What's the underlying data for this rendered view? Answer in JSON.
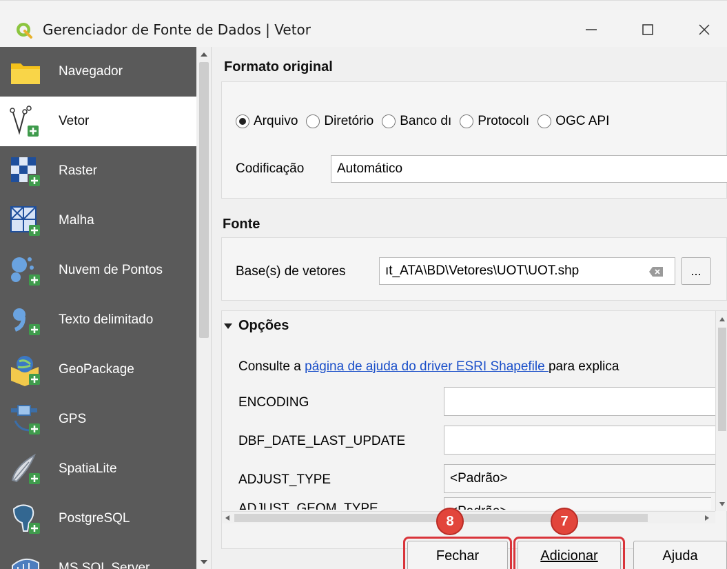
{
  "window": {
    "title": "Gerenciador de Fonte de Dados | Vetor",
    "minimize_glyph": "—",
    "maximize_glyph": "☐",
    "close_glyph": "✕"
  },
  "sidebar": {
    "items": [
      {
        "label": "Navegador",
        "icon": "folder-icon"
      },
      {
        "label": "Vetor",
        "icon": "vector-icon",
        "selected": true
      },
      {
        "label": "Raster",
        "icon": "raster-icon"
      },
      {
        "label": "Malha",
        "icon": "mesh-icon"
      },
      {
        "label": "Nuvem de Pontos",
        "icon": "point-cloud-icon"
      },
      {
        "label": "Texto delimitado",
        "icon": "delimited-text-icon"
      },
      {
        "label": "GeoPackage",
        "icon": "geopackage-icon"
      },
      {
        "label": "GPS",
        "icon": "gps-icon"
      },
      {
        "label": "SpatiaLite",
        "icon": "spatialite-icon"
      },
      {
        "label": "PostgreSQL",
        "icon": "postgresql-icon"
      },
      {
        "label": "MS SQL Server",
        "icon": "mssql-icon"
      }
    ]
  },
  "formato": {
    "title": "Formato original",
    "radios": [
      {
        "label": "Arquivo",
        "checked": true
      },
      {
        "label": "Diretório",
        "checked": false
      },
      {
        "label": "Banco dı",
        "checked": false
      },
      {
        "label": "Protocolı",
        "checked": false
      },
      {
        "label": "OGC API",
        "checked": false
      }
    ],
    "encoding_label": "Codificação",
    "encoding_value": "Automático"
  },
  "fonte": {
    "title": "Fonte",
    "label": "Base(s) de vetores",
    "value": "ıt_ATA\\BD\\Vetores\\UOT\\UOT.shp",
    "browse": "..."
  },
  "opcoes": {
    "title": "Opções",
    "help_prefix": "Consulte a ",
    "help_link": "página de ajuda do driver ESRI Shapefile ",
    "help_suffix": "para explica",
    "rows": [
      {
        "label": "ENCODING",
        "value": ""
      },
      {
        "label": "DBF_DATE_LAST_UPDATE",
        "value": ""
      },
      {
        "label": "ADJUST_TYPE",
        "value": "<Padrão>"
      },
      {
        "label": "ADJUST_GEOM_TYPE",
        "value": "<Padrão>"
      }
    ]
  },
  "buttons": {
    "close": "Fechar",
    "add": "Adicionar",
    "help": "Ajuda"
  },
  "badges": {
    "close_step": "8",
    "add_step": "7"
  },
  "colors": {
    "sidebar_bg": "#5a5a5a",
    "highlight": "#d9343a",
    "link": "#1a4fc9"
  }
}
